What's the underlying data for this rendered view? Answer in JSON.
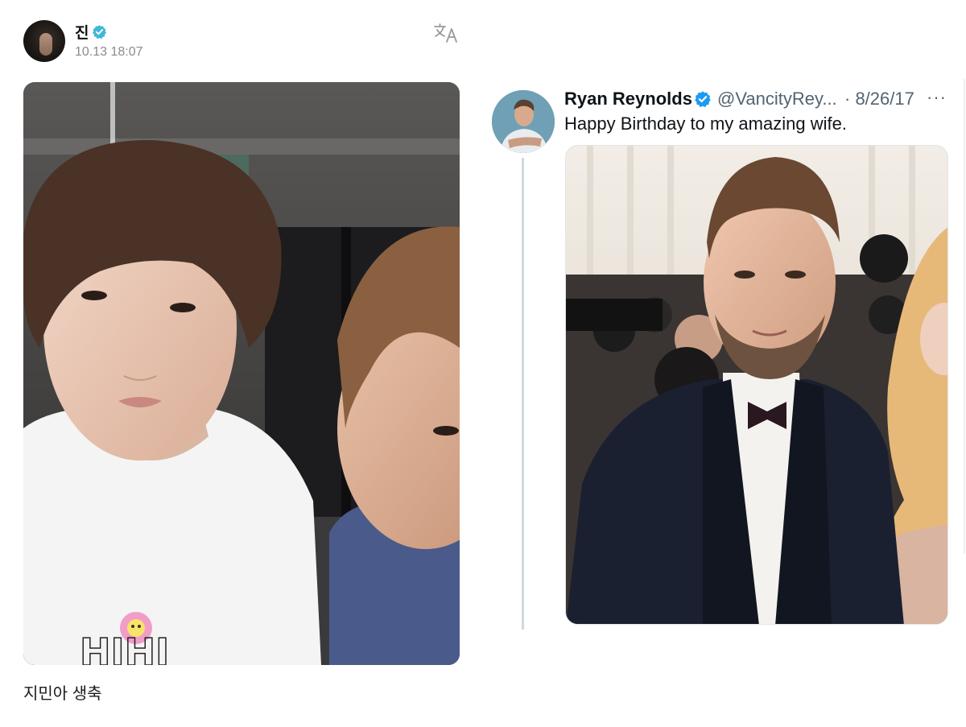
{
  "left_post": {
    "author_name": "진",
    "timestamp": "10.13 18:07",
    "caption": "지민아 생축",
    "icons": {
      "verified": "verified-badge-icon",
      "translate": "translate-icon"
    }
  },
  "right_post": {
    "display_name": "Ryan Reynolds",
    "handle": "@VancityRey...",
    "date": "· 8/26/17",
    "more": "···",
    "text": "Happy Birthday to my amazing wife.",
    "icons": {
      "verified": "verified-badge-icon",
      "more": "more-icon"
    }
  },
  "colors": {
    "verified_blue": "#1d9bf0",
    "weverse_verified": "#3fb9d6",
    "muted_text": "#536471",
    "thread_line": "#cfd9de"
  }
}
